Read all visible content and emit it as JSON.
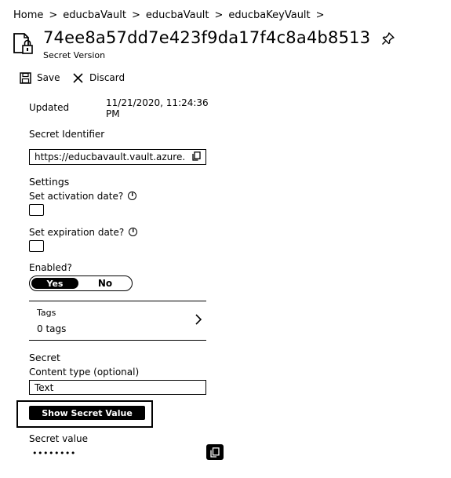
{
  "breadcrumb": {
    "items": [
      "Home",
      "educbaVault",
      "educbaVault",
      "educbaKeyVault"
    ],
    "separator": ">"
  },
  "header": {
    "title": "74ee8a57dd7e423f9da17f4c8a4b8513",
    "subtitle": "Secret Version",
    "icon": "secret-version-icon",
    "pin_icon": "pin-icon"
  },
  "toolbar": {
    "save_label": "Save",
    "discard_label": "Discard"
  },
  "details": {
    "updated_label": "Updated",
    "updated_value_line1": "11/21/2020, 11:24:36",
    "updated_value_line2": "PM",
    "identifier_label": "Secret Identifier",
    "identifier_value": "https://educbavault.vault.azure."
  },
  "settings": {
    "heading": "Settings",
    "activation_label": "Set activation date?",
    "expiration_label": "Set expiration date?",
    "enabled_label": "Enabled?",
    "enabled_yes": "Yes",
    "enabled_no": "No",
    "enabled_selected": "Yes"
  },
  "tags": {
    "label": "Tags",
    "count_text": "0 tags"
  },
  "secret": {
    "heading": "Secret",
    "content_type_label": "Content type (optional)",
    "content_type_value": "Text",
    "show_button_label": "Show Secret Value",
    "value_label": "Secret value",
    "value_masked": "••••••••"
  },
  "colors": {
    "foreground": "#000000",
    "background": "#ffffff"
  }
}
